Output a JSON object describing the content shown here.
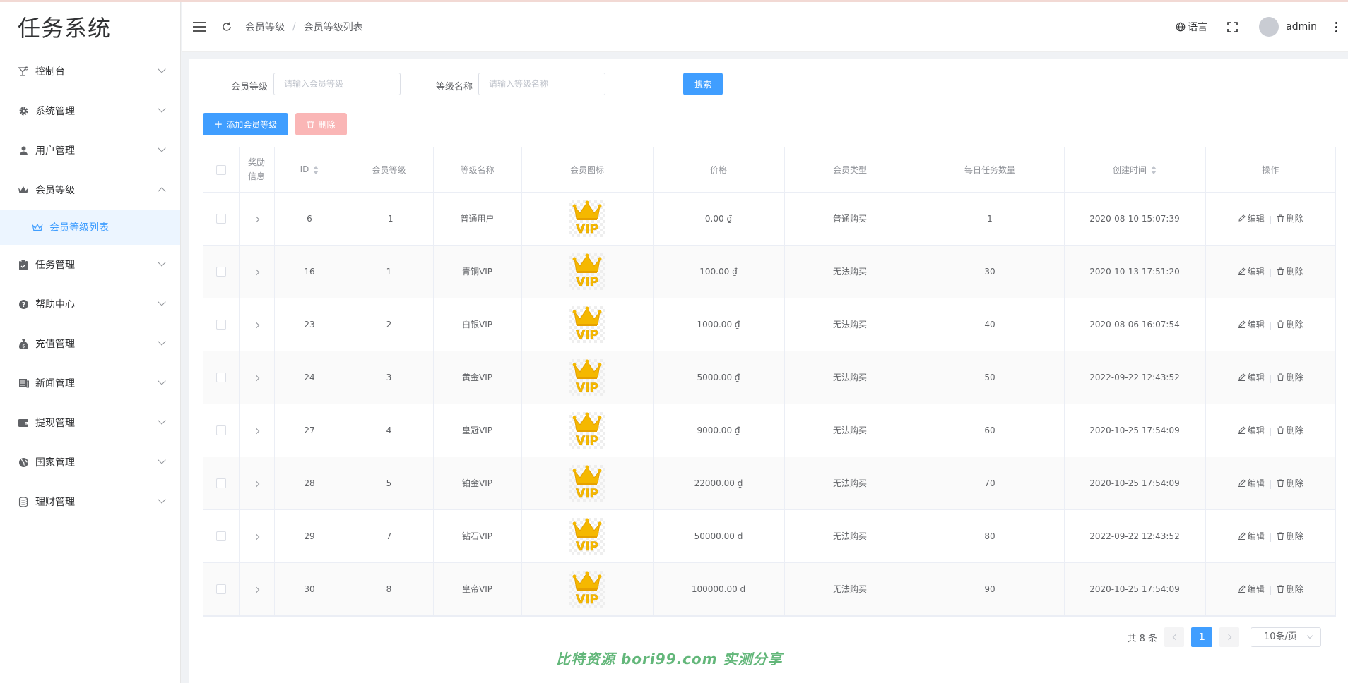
{
  "sidebar": {
    "logo": "任务系统",
    "items": [
      {
        "label": "控制台",
        "icon": "cocktail-icon"
      },
      {
        "label": "系统管理",
        "icon": "gear-icon"
      },
      {
        "label": "用户管理",
        "icon": "user-icon"
      },
      {
        "label": "会员等级",
        "icon": "crown-icon",
        "expanded": true
      },
      {
        "label": "任务管理",
        "icon": "clipboard-icon"
      },
      {
        "label": "帮助中心",
        "icon": "question-icon"
      },
      {
        "label": "充值管理",
        "icon": "moneybag-icon"
      },
      {
        "label": "新闻管理",
        "icon": "news-icon"
      },
      {
        "label": "提现管理",
        "icon": "wallet-icon"
      },
      {
        "label": "国家管理",
        "icon": "globe-icon"
      },
      {
        "label": "理财管理",
        "icon": "coins-icon"
      }
    ],
    "submenu_active": "会员等级列表",
    "accent_color": "#409eff"
  },
  "header": {
    "breadcrumb": [
      "会员等级",
      "会员等级列表"
    ],
    "language_label": "语言",
    "username": "admin"
  },
  "search": {
    "level_label": "会员等级",
    "level_placeholder": "请输入会员等级",
    "name_label": "等级名称",
    "name_placeholder": "请输入等级名称",
    "search_button": "搜索"
  },
  "toolbar": {
    "add_label": "添加会员等级",
    "delete_label": "删除"
  },
  "table": {
    "headers": {
      "reward": "奖励信息",
      "id": "ID",
      "level": "会员等级",
      "name": "等级名称",
      "icon": "会员图标",
      "price": "价格",
      "type": "会员类型",
      "daily_tasks": "每日任务数量",
      "created": "创建时间",
      "ops": "操作"
    },
    "edit_label": "编辑",
    "delete_label": "删除",
    "vip_icon_text": "VIP",
    "rows": [
      {
        "id": "6",
        "level": "-1",
        "name": "普通用户",
        "price": "0.00 ₫",
        "type": "普通购买",
        "daily": "1",
        "created": "2020-08-10 15:07:39"
      },
      {
        "id": "16",
        "level": "1",
        "name": "青铜VIP",
        "price": "100.00 ₫",
        "type": "无法购买",
        "daily": "30",
        "created": "2020-10-13 17:51:20"
      },
      {
        "id": "23",
        "level": "2",
        "name": "白银VIP",
        "price": "1000.00 ₫",
        "type": "无法购买",
        "daily": "40",
        "created": "2020-08-06 16:07:54"
      },
      {
        "id": "24",
        "level": "3",
        "name": "黄金VIP",
        "price": "5000.00 ₫",
        "type": "无法购买",
        "daily": "50",
        "created": "2022-09-22 12:43:52"
      },
      {
        "id": "27",
        "level": "4",
        "name": "皇冠VIP",
        "price": "9000.00 ₫",
        "type": "无法购买",
        "daily": "60",
        "created": "2020-10-25 17:54:09"
      },
      {
        "id": "28",
        "level": "5",
        "name": "铂金VIP",
        "price": "22000.00 ₫",
        "type": "无法购买",
        "daily": "70",
        "created": "2020-10-25 17:54:09"
      },
      {
        "id": "29",
        "level": "7",
        "name": "钻石VIP",
        "price": "50000.00 ₫",
        "type": "无法购买",
        "daily": "80",
        "created": "2022-09-22 12:43:52"
      },
      {
        "id": "30",
        "level": "8",
        "name": "皇帝VIP",
        "price": "100000.00 ₫",
        "type": "无法购买",
        "daily": "90",
        "created": "2020-10-25 17:54:09"
      }
    ]
  },
  "pagination": {
    "total_text": "共 8 条",
    "current_page": "1",
    "page_size": "10条/页"
  },
  "watermark": "比特资源 bori99.com 实测分享"
}
